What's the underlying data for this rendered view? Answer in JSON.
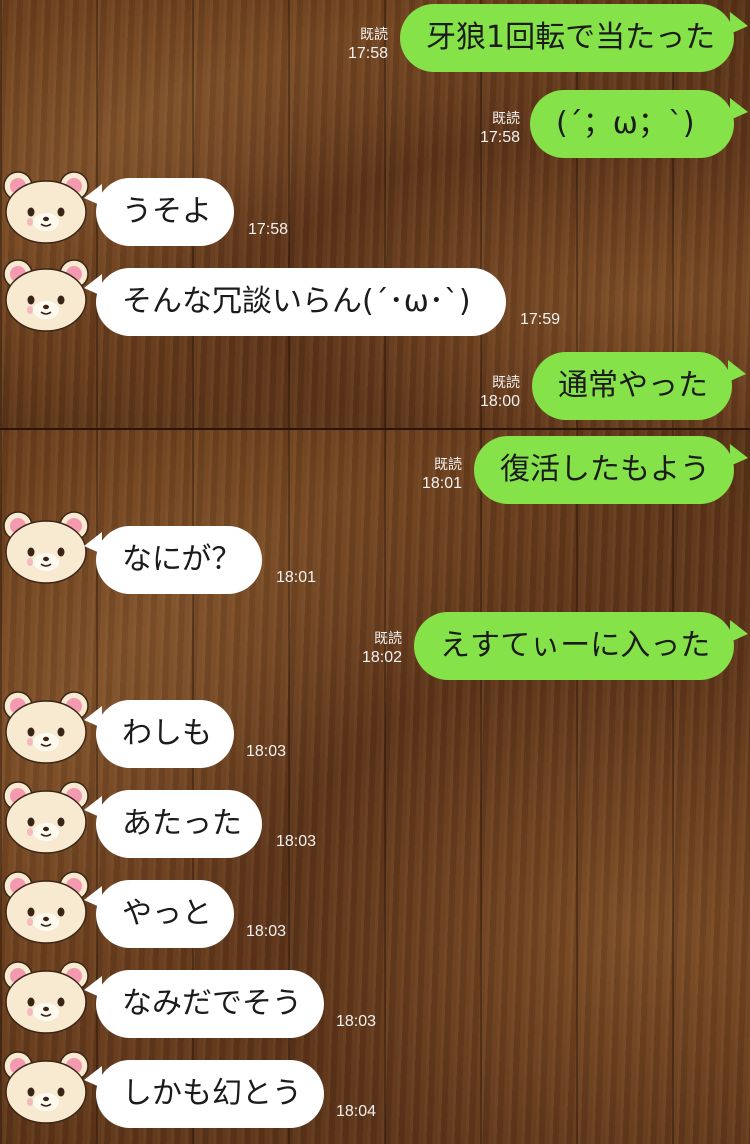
{
  "colors": {
    "bubble_out": "#85e249",
    "bubble_in": "#ffffff",
    "time_text": "#f2f2f2"
  },
  "avatar_icon": "bear-avatar-icon",
  "messages": [
    {
      "text": "牙狼1回転で当たった",
      "read": "既読",
      "time": "17:58"
    },
    {
      "text": "(´；ω；`)",
      "read": "既読",
      "time": "17:58"
    },
    {
      "text": "うそよ",
      "time": "17:58"
    },
    {
      "text": "そんな冗談いらん(´･ω･`)",
      "time": "17:59"
    },
    {
      "text": "通常やった",
      "read": "既読",
      "time": "18:00"
    },
    {
      "text": "復活したもよう",
      "read": "既読",
      "time": "18:01"
    },
    {
      "text": "なにが？",
      "time": "18:01"
    },
    {
      "text": "えすてぃーに入った",
      "read": "既読",
      "time": "18:02"
    },
    {
      "text": "わしも",
      "time": "18:03"
    },
    {
      "text": "あたった",
      "time": "18:03"
    },
    {
      "text": "やっと",
      "time": "18:03"
    },
    {
      "text": "なみだでそう",
      "time": "18:03"
    },
    {
      "text": "しかも幻とう",
      "time": "18:04"
    }
  ]
}
